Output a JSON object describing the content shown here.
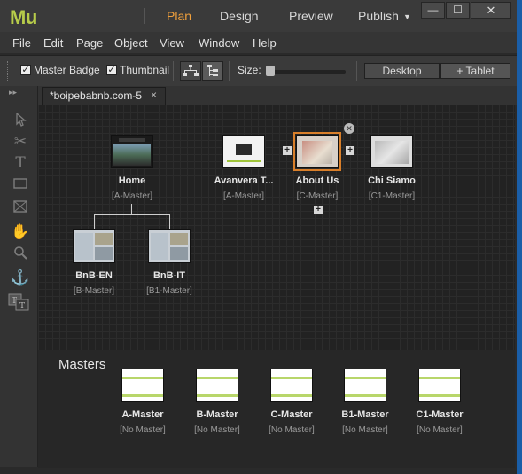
{
  "app": {
    "logo": "Mu",
    "modes": [
      "Plan",
      "Design",
      "Preview",
      "Publish"
    ],
    "active_mode": "Plan",
    "window_buttons": {
      "minimize": "—",
      "maximize": "☐",
      "close": "✕"
    }
  },
  "menu": [
    "File",
    "Edit",
    "Page",
    "Object",
    "View",
    "Window",
    "Help"
  ],
  "toolbar": {
    "master_badge": {
      "label": "Master Badge",
      "checked": true
    },
    "thumbnail": {
      "label": "Thumbnail",
      "checked": true
    },
    "size_label": "Size:",
    "size_value": 0.05,
    "desktop_label": "Desktop",
    "tablet_label": "+ Tablet"
  },
  "document": {
    "tab_title": "*boipebabnb.com-5",
    "tab_close": "×"
  },
  "pages": [
    {
      "name": "Home",
      "master": "[A-Master]"
    },
    {
      "name": "Avanvera T...",
      "master": "[A-Master]"
    },
    {
      "name": "About Us",
      "master": "[C-Master]",
      "selected": true
    },
    {
      "name": "Chi Siamo",
      "master": "[C1-Master]"
    },
    {
      "name": "BnB-EN",
      "master": "[B-Master]"
    },
    {
      "name": "BnB-IT",
      "master": "[B1-Master]"
    }
  ],
  "plus_glyph": "+",
  "remove_glyph": "✕",
  "masters_section": {
    "title": "Masters",
    "items": [
      {
        "name": "A-Master",
        "master": "[No Master]"
      },
      {
        "name": "B-Master",
        "master": "[No Master]"
      },
      {
        "name": "C-Master",
        "master": "[No Master]"
      },
      {
        "name": "B1-Master",
        "master": "[No Master]"
      },
      {
        "name": "C1-Master",
        "master": "[No Master]"
      }
    ]
  },
  "colors": {
    "accent": "#f0a03c",
    "logo": "#b7cc4a",
    "selection": "#d97f2a",
    "master_stripe": "#b8d66a"
  }
}
